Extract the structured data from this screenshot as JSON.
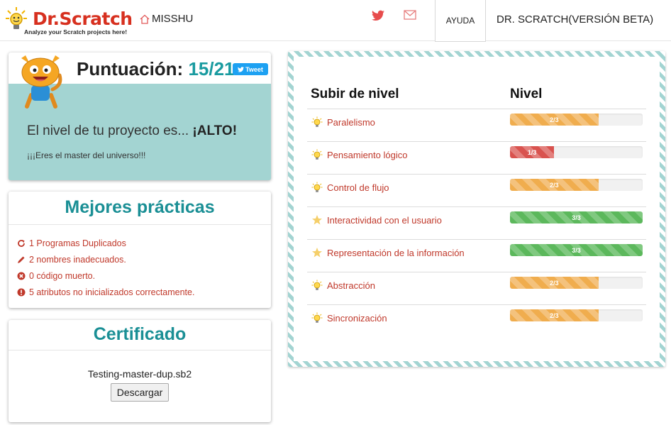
{
  "navbar": {
    "brand": "Dr.Scratch",
    "tagline": "Analyze your Scratch projects here!",
    "home_label": "MISSHU",
    "help_label": "AYUDA",
    "version_label": "DR. SCRATCH(VERSIÓN BETA)",
    "twitter_icon": "twitter-icon",
    "mail_icon": "mail-icon"
  },
  "score": {
    "label": "Puntuación:",
    "value": "15/21",
    "tweet_label": "Tweet",
    "level_text": "El nivel de tu proyecto es...",
    "level_value": "¡ALTO!",
    "message": "¡¡¡Eres el master del universo!!!"
  },
  "best_practices": {
    "title": "Mejores prácticas",
    "items": [
      {
        "icon": "refresh-icon",
        "text": "1 Programas Duplicados"
      },
      {
        "icon": "pencil-icon",
        "text": "2 nombres inadecuados."
      },
      {
        "icon": "remove-circle-icon",
        "text": "0 código muerto."
      },
      {
        "icon": "exclamation-circle-icon",
        "text": "5 atributos no inicializados correctamente."
      }
    ]
  },
  "certificate": {
    "title": "Certificado",
    "filename": "Testing-master-dup.sb2",
    "download_label": "Descargar"
  },
  "levels": {
    "header_skill": "Subir de nivel",
    "header_level": "Nivel",
    "rows": [
      {
        "name": "Paralelismo",
        "icon": "lightbulb-icon",
        "label": "2/3",
        "fraction": 0.6667,
        "status": "orange"
      },
      {
        "name": "Pensamiento lógico",
        "icon": "lightbulb-icon",
        "label": "1/3",
        "fraction": 0.3333,
        "status": "red"
      },
      {
        "name": "Control de flujo",
        "icon": "lightbulb-icon",
        "label": "2/3",
        "fraction": 0.6667,
        "status": "orange"
      },
      {
        "name": "Interactividad con el usuario",
        "icon": "star-icon",
        "label": "3/3",
        "fraction": 1.0,
        "status": "green"
      },
      {
        "name": "Representación de la información",
        "icon": "star-icon",
        "label": "3/3",
        "fraction": 1.0,
        "status": "green"
      },
      {
        "name": "Abstracción",
        "icon": "lightbulb-icon",
        "label": "2/3",
        "fraction": 0.6667,
        "status": "orange"
      },
      {
        "name": "Sincronización",
        "icon": "lightbulb-icon",
        "label": "2/3",
        "fraction": 0.6667,
        "status": "orange"
      }
    ]
  },
  "colors": {
    "accent_teal": "#1a8f95",
    "brand_red": "#d7301f",
    "link_red": "#c0392b",
    "panel_teal": "#a3d4d2"
  }
}
